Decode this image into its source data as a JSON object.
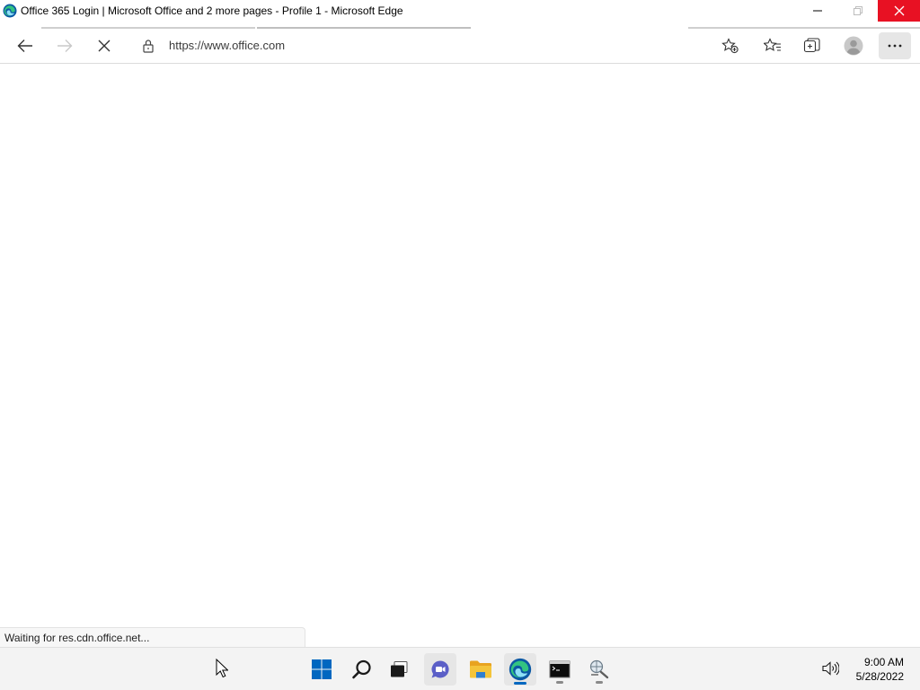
{
  "window": {
    "title": "Office 365 Login | Microsoft Office and 2 more pages - Profile 1 - Microsoft Edge"
  },
  "toolbar": {
    "url": "https://www.office.com",
    "back_icon": "arrow-left-icon",
    "forward_icon": "arrow-right-icon",
    "stop_icon": "close-icon",
    "more_label": "···"
  },
  "status": {
    "text": "Waiting for res.cdn.office.net..."
  },
  "taskbar": {
    "time": "9:00 AM",
    "date": "5/28/2022",
    "items": [
      "start",
      "search",
      "task-view",
      "chat",
      "file-explorer",
      "edge",
      "terminal",
      "tool"
    ]
  },
  "colors": {
    "close_red": "#e81123",
    "edge_blue": "#0078d4",
    "windows_blue": "#0067c0",
    "chat_purple": "#5b5fc7",
    "folder_yellow": "#f4c43a"
  }
}
